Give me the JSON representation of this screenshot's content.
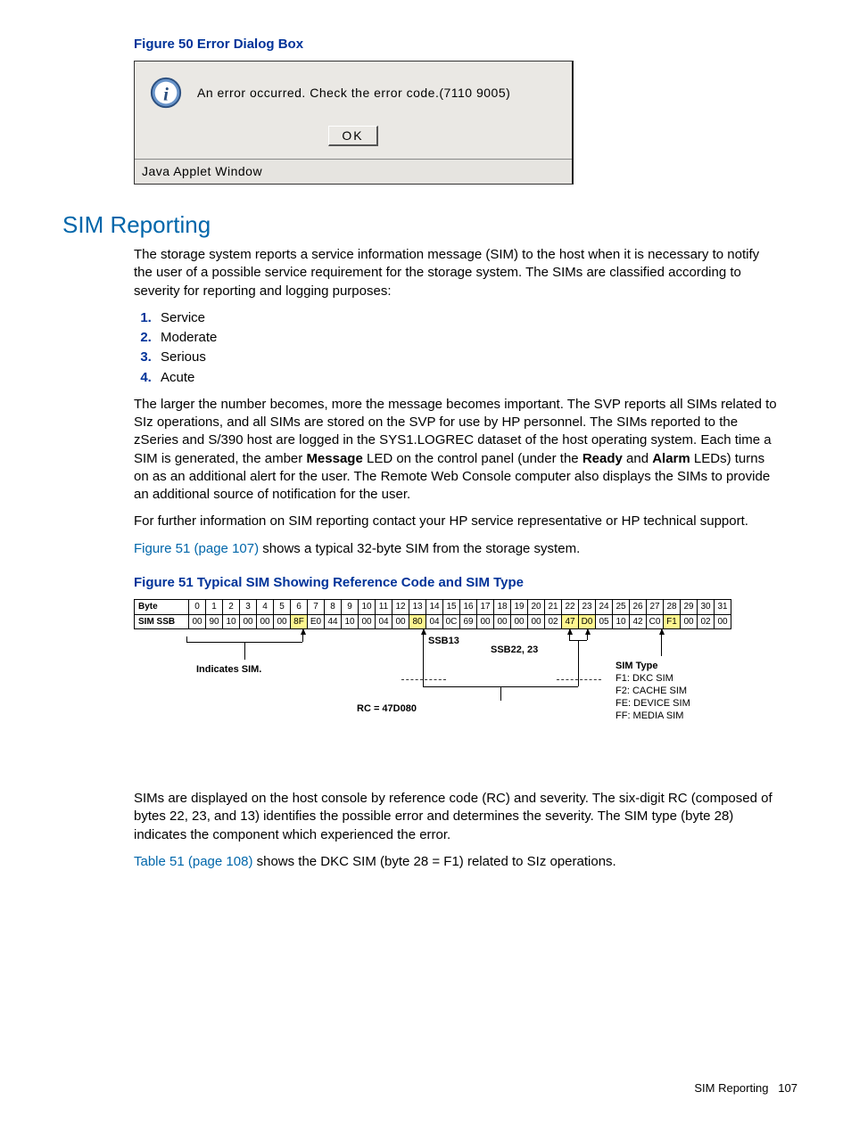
{
  "figure50": {
    "caption": "Figure 50 Error Dialog Box",
    "message": "An error occurred. Check the error code.(7110 9005)",
    "ok": "OK",
    "status": "Java Applet Window"
  },
  "section_heading": "SIM Reporting",
  "para1": "The storage system reports a service information message (SIM) to the host when it is necessary to notify the user of a possible service requirement for the storage system. The SIMs are classified according to severity for reporting and logging purposes:",
  "severity": [
    "Service",
    "Moderate",
    "Serious",
    "Acute"
  ],
  "para2_a": "The larger the number becomes, more the message becomes important. The SVP reports all SIMs related to SIz operations, and all SIMs are stored on the SVP for use by HP personnel. The SIMs reported to the zSeries and S/390 host are logged in the SYS1.LOGREC dataset of the host operating system. Each time a SIM is generated, the amber ",
  "para2_b": " LED on the control panel (under the ",
  "para2_c": " and ",
  "para2_d": " LEDs) turns on as an additional alert for the user. The Remote Web Console computer also displays the SIMs to provide an additional source of notification for the user.",
  "bold": {
    "message": "Message",
    "ready": "Ready",
    "alarm": "Alarm"
  },
  "para3": "For further information on SIM reporting contact your HP service representative or HP technical support.",
  "para4_link": "Figure 51 (page 107)",
  "para4_rest": " shows a typical 32-byte SIM from the storage system.",
  "figure51": {
    "caption": "Figure 51 Typical SIM Showing Reference Code and SIM Type",
    "byte_label": "Byte",
    "ssb_label": "SIM SSB",
    "bytes": [
      "0",
      "1",
      "2",
      "3",
      "4",
      "5",
      "6",
      "7",
      "8",
      "9",
      "10",
      "11",
      "12",
      "13",
      "14",
      "15",
      "16",
      "17",
      "18",
      "19",
      "20",
      "21",
      "22",
      "23",
      "24",
      "25",
      "26",
      "27",
      "28",
      "29",
      "30",
      "31"
    ],
    "ssb": [
      "00",
      "90",
      "10",
      "00",
      "00",
      "00",
      "8F",
      "E0",
      "44",
      "10",
      "00",
      "04",
      "00",
      "80",
      "04",
      "0C",
      "69",
      "00",
      "00",
      "00",
      "00",
      "02",
      "47",
      "D0",
      "05",
      "10",
      "42",
      "C0",
      "F1",
      "00",
      "02",
      "00"
    ],
    "hilite_idx": [
      6,
      13,
      22,
      23,
      28
    ],
    "annot": {
      "indicates": "Indicates SIM.",
      "ssb13": "SSB13",
      "ssb2223": "SSB22, 23",
      "rc": "RC = 47D080",
      "simtype_head": "SIM Type",
      "types": [
        "F1: DKC SIM",
        "F2: CACHE SIM",
        "FE: DEVICE SIM",
        "FF: MEDIA SIM"
      ]
    }
  },
  "para5": "SIMs are displayed on the host console by reference code (RC) and severity. The six-digit RC (composed of bytes 22, 23, and 13) identifies the possible error and determines the severity. The SIM type (byte 28) indicates the component which experienced the error.",
  "para6_link": "Table 51 (page 108)",
  "para6_rest": " shows the DKC SIM (byte 28 = F1) related to SIz operations.",
  "footer": {
    "label": "SIM Reporting",
    "page": "107"
  }
}
